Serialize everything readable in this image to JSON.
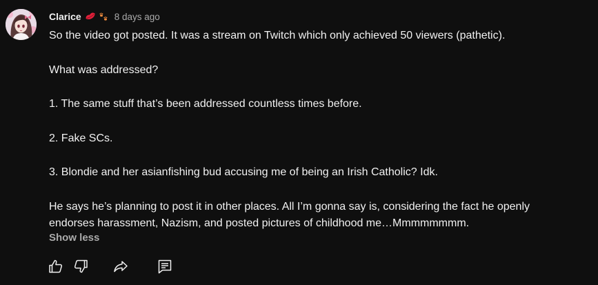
{
  "comment": {
    "author": "Clarice",
    "timestamp": "8 days ago",
    "badge_icons": [
      "lips-icon",
      "paw-prints-icon"
    ],
    "paragraphs": [
      [
        "So the video got posted. It was a stream on Twitch which only achieved 50 viewers (pathetic)."
      ],
      [
        "What was addressed?"
      ],
      [
        "1. The same stuff that’s been addressed countless times before."
      ],
      [
        "2. Fake SCs."
      ],
      [
        "3. Blondie and her asianfishing bud accusing me of being an Irish Catholic?  Idk."
      ],
      [
        "He says he’s planning to post it in other places.  All I’m gonna say is, considering the fact he openly",
        "endorses harassment, Nazism, and posted pictures of childhood me…Mmmmmmmm."
      ]
    ],
    "show_less_label": "Show less"
  },
  "actions": {
    "like_icon": "thumbs-up-icon",
    "dislike_icon": "thumbs-down-icon",
    "share_icon": "share-arrow-icon",
    "reply_icon": "reply-comment-icon"
  },
  "colors": {
    "background": "#0f0f0f",
    "text": "#f1f1f1",
    "secondary": "#aaaaaa",
    "lips": "#e0203a",
    "paws": "#f08a3c"
  }
}
